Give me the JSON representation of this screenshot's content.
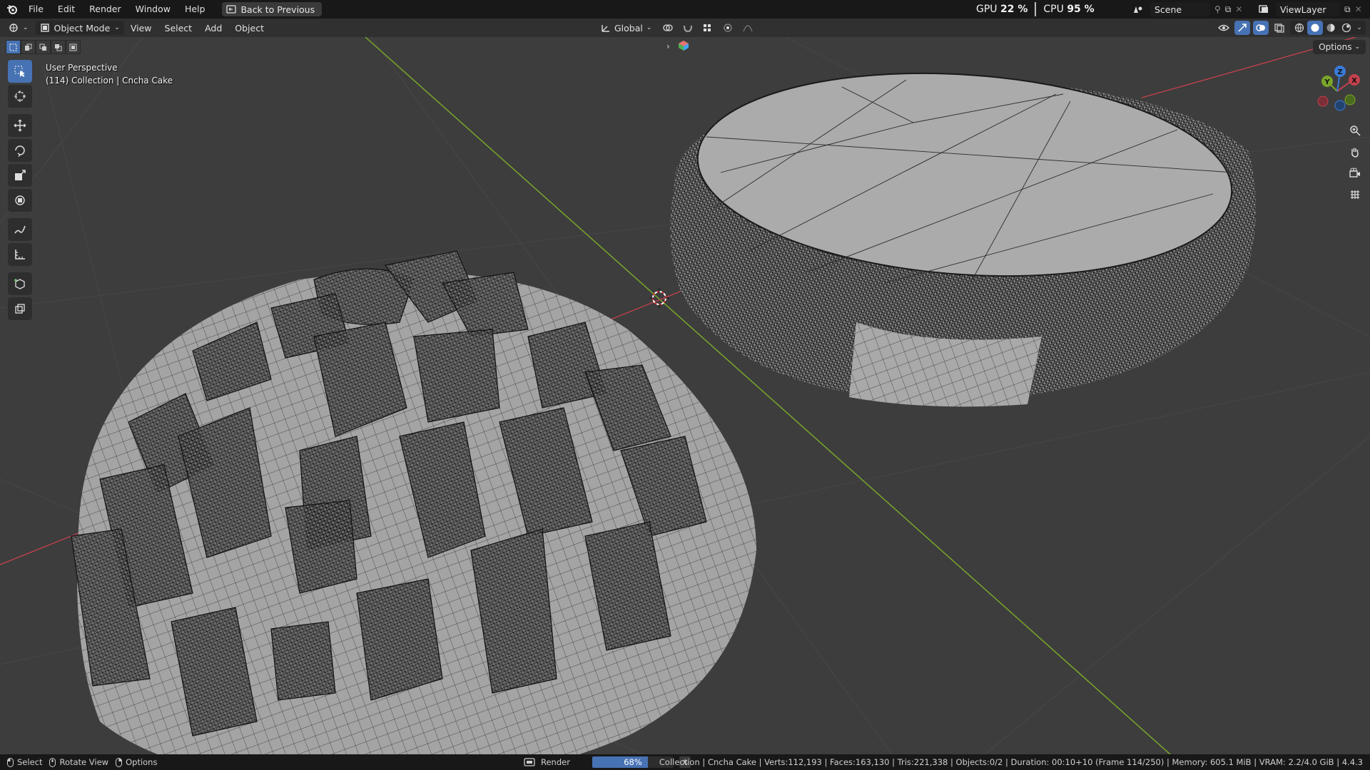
{
  "menubar": {
    "items": [
      "File",
      "Edit",
      "Render",
      "Window",
      "Help"
    ],
    "back_button": "Back to Previous",
    "gpu_label": "GPU",
    "gpu_value": "22 %",
    "cpu_label": "CPU",
    "cpu_value": "95 %",
    "scene_name": "Scene",
    "view_layer_name": "ViewLayer"
  },
  "header": {
    "mode": "Object Mode",
    "menus": [
      "View",
      "Select",
      "Add",
      "Object"
    ],
    "orientation": "Global",
    "options_label": "Options"
  },
  "viewport": {
    "perspective_label": "User Perspective",
    "collection_label": "(114) Collection | Cncha Cake",
    "gizmo_axes": {
      "x": "X",
      "y": "Y",
      "z": "Z"
    }
  },
  "toolbar": {
    "tools": [
      "select-box-icon",
      "cursor-icon",
      "move-icon",
      "rotate-icon",
      "scale-icon",
      "transform-icon",
      "annotate-icon",
      "measure-icon",
      "add-cube-icon",
      "extrude-cube-icon"
    ]
  },
  "statusbar": {
    "hints": [
      {
        "icon": "mouse-left-icon",
        "label": "Select"
      },
      {
        "icon": "mouse-middle-icon",
        "label": "Rotate View"
      },
      {
        "icon": "mouse-right-icon",
        "label": "Options"
      }
    ],
    "render_job_label": "Render",
    "render_progress": 0.68,
    "render_progress_label": "68%",
    "stats": "Collection | Cncha Cake | Verts:112,193 | Faces:163,130 | Tris:221,338 | Objects:0/2 | Duration: 00:10+10 (Frame 114/250) | Memory: 605.1 MiB | VRAM: 2.2/4.0 GiB | 4.4.3"
  },
  "colors": {
    "accent": "#4772b3",
    "axis_x": "#c4414e",
    "axis_y": "#7aa62a",
    "axis_z": "#3a7ad8",
    "viewport_bg": "#3d3d3d",
    "mesh_fill": "#9c9c9c"
  }
}
